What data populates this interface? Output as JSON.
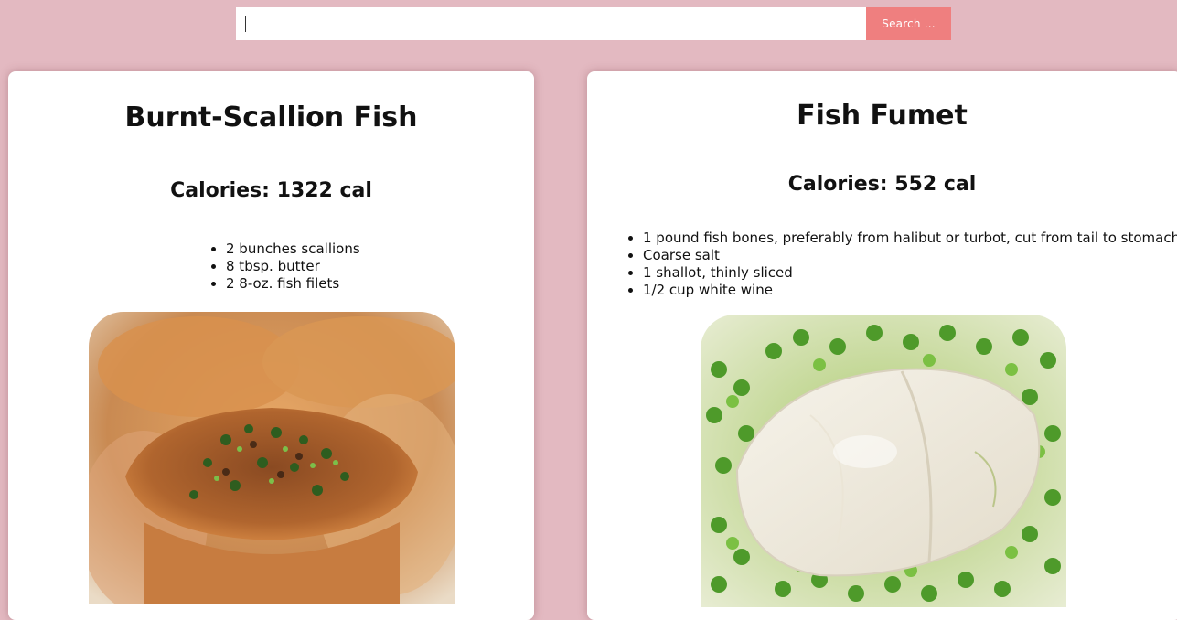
{
  "search": {
    "placeholder": "",
    "value": "",
    "button_label": "Search ..."
  },
  "recipes": [
    {
      "title": "Burnt-Scallion Fish",
      "calories": "Calories: 1322 cal",
      "ingredients": [
        "2 bunches scallions",
        "8 tbsp. butter",
        "2 8-oz. fish filets"
      ]
    },
    {
      "title": "Fish Fumet",
      "calories": "Calories: 552 cal",
      "ingredients": [
        "1 pound fish bones, preferably from halibut or turbot, cut from tail to stomach",
        "Coarse salt",
        "1 shallot, thinly sliced",
        "1/2 cup white wine"
      ]
    }
  ]
}
